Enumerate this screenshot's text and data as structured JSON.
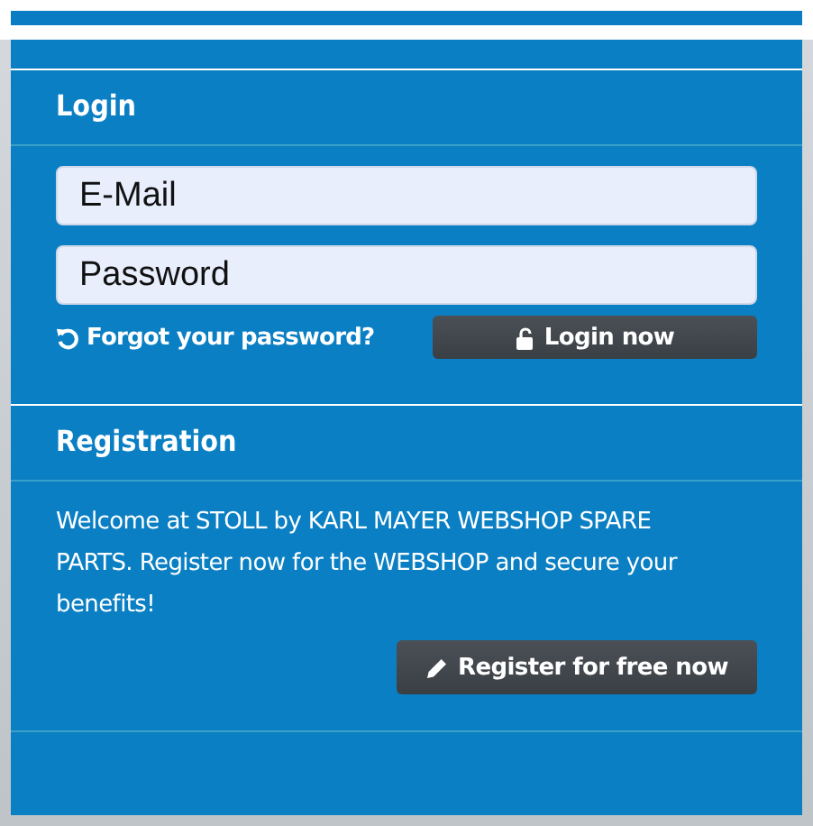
{
  "login": {
    "title": "Login",
    "fields": [
      {
        "placeholder": "E-Mail"
      },
      {
        "placeholder": "Password"
      }
    ],
    "forgot_link": "Forgot your password?",
    "submit_button": "Login now"
  },
  "registration": {
    "title": "Registration",
    "text": "Welcome at STOLL by KARL MAYER WEBSHOP SPARE PARTS. Register now for the WEBSHOP and secure your benefits!",
    "button": "Register for free now"
  }
}
